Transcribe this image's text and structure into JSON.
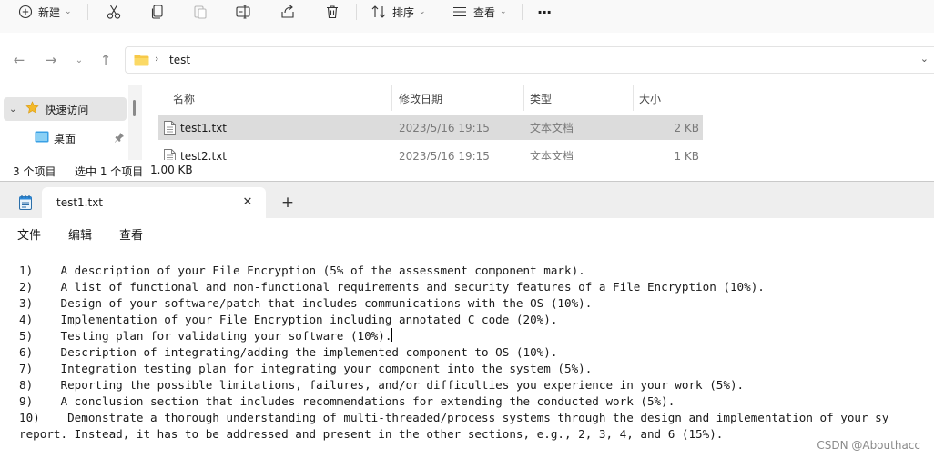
{
  "explorer": {
    "toolbar": {
      "new_label": "新建",
      "sort_label": "排序",
      "view_label": "查看",
      "more_label": "···"
    },
    "address": {
      "path": "test"
    },
    "nav": {
      "quick_access": "快速访问",
      "desktop": "桌面"
    },
    "columns": {
      "name": "名称",
      "modified": "修改日期",
      "type": "类型",
      "size": "大小"
    },
    "files": [
      {
        "name": "test1.txt",
        "modified": "2023/5/16 19:15",
        "type": "文本文档",
        "size": "2 KB"
      },
      {
        "name": "test2.txt",
        "modified": "2023/5/16 19:15",
        "type": "文本文档",
        "size": "1 KB"
      }
    ],
    "status": {
      "count": "3 个项目",
      "selected": "选中 1 个项目",
      "selected_size": "1.00 KB"
    }
  },
  "notepad": {
    "tab_title": "test1.txt",
    "new_tab_symbol": "+",
    "menu": {
      "file": "文件",
      "edit": "编辑",
      "view": "查看"
    },
    "lines": [
      "1)    A description of your File Encryption (5% of the assessment component mark).",
      "2)    A list of functional and non-functional requirements and security features of a File Encryption (10%).",
      "3)    Design of your software/patch that includes communications with the OS (10%).",
      "4)    Implementation of your File Encryption including annotated C code (20%).",
      "5)    Testing plan for validating your software (10%).",
      "6)    Description of integrating/adding the implemented component to OS (10%).",
      "7)    Integration testing plan for integrating your component into the system (5%).",
      "8)    Reporting the possible limitations, failures, and/or difficulties you experience in your work (5%).",
      "9)    A conclusion section that includes recommendations for extending the conducted work (5%).",
      "10)    Demonstrate a thorough understanding of multi-threaded/process systems through the design and implementation of your sy",
      "report. Instead, it has to be addressed and present in the other sections, e.g., 2, 3, 4, and 6 (15%)."
    ]
  },
  "watermark": "CSDN @Abouthacc"
}
